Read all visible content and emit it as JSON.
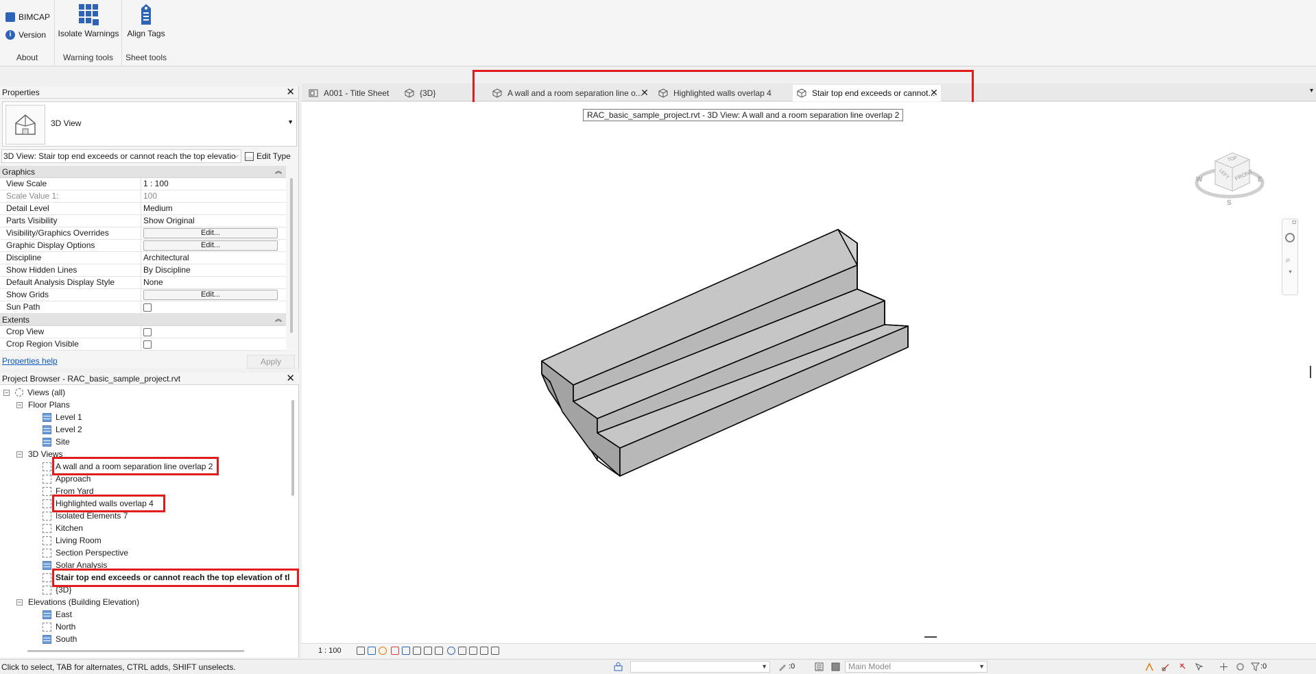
{
  "ribbon": {
    "about": {
      "label": "About",
      "bimcap": "BIMCAP",
      "version": "Version"
    },
    "warning_tools": {
      "label": "Warning tools",
      "isolate": "Isolate Warnings"
    },
    "sheet_tools": {
      "label": "Sheet tools",
      "align": "Align Tags"
    }
  },
  "tabs": [
    {
      "label": "A001 - Title Sheet",
      "icon": "sheet-icon"
    },
    {
      "label": "{3D}",
      "icon": "3d-view-icon"
    },
    {
      "label": "A wall and a room separation line o...",
      "icon": "3d-view-icon",
      "close": "✕"
    },
    {
      "label": "Highlighted walls overlap 4",
      "icon": "3d-view-icon"
    },
    {
      "label": "Stair top end exceeds or cannot...",
      "icon": "3d-view-icon",
      "close": "✕",
      "active": true
    }
  ],
  "tooltip": "RAC_basic_sample_project.rvt - 3D View: A wall and a room separation line overlap 2",
  "properties": {
    "title": "Properties",
    "type_name": "3D View",
    "instance": "3D View: Stair top end exceeds or cannot reach the top elevatio",
    "edit_type": "Edit Type",
    "sections": {
      "graphics": "Graphics",
      "extents": "Extents"
    },
    "rows": [
      {
        "name": "View Scale",
        "value": "1 : 100"
      },
      {
        "name": "Scale Value    1:",
        "value": "100"
      },
      {
        "name": "Detail Level",
        "value": "Medium"
      },
      {
        "name": "Parts Visibility",
        "value": "Show Original"
      },
      {
        "name": "Visibility/Graphics Overrides",
        "value": "Edit..."
      },
      {
        "name": "Graphic Display Options",
        "value": "Edit..."
      },
      {
        "name": "Discipline",
        "value": "Architectural"
      },
      {
        "name": "Show Hidden Lines",
        "value": "By Discipline"
      },
      {
        "name": "Default Analysis Display Style",
        "value": "None"
      },
      {
        "name": "Show Grids",
        "value": "Edit..."
      },
      {
        "name": "Sun Path",
        "value": ""
      },
      {
        "name": "Crop View",
        "value": ""
      },
      {
        "name": "Crop Region Visible",
        "value": ""
      }
    ],
    "help": "Properties help",
    "apply": "Apply"
  },
  "browser": {
    "title": "Project Browser - RAC_basic_sample_project.rvt",
    "views_all": "Views (all)",
    "floor_plans": "Floor Plans",
    "plans": [
      "Level 1",
      "Level 2",
      "Site"
    ],
    "views_3d": "3D Views",
    "views3d": [
      "A wall and a room separation line overlap 2",
      "Approach",
      "From Yard",
      "Highlighted walls overlap 4",
      "Isolated Elements 7",
      "Kitchen",
      "Living Room",
      "Section Perspective",
      "Solar Analysis",
      "Stair top end exceeds or cannot reach the top elevation of tl",
      "{3D}"
    ],
    "elevations": "Elevations (Building Elevation)",
    "elev_items": [
      "East",
      "North",
      "South"
    ]
  },
  "viewcube": {
    "top": "TOP",
    "left": "LEFT",
    "front": "FRONT",
    "w": "W",
    "e": "E",
    "s": "S"
  },
  "view_bar": {
    "scale": "1 : 100"
  },
  "status": {
    "text": "Click to select, TAB for alternates, CTRL adds, SHIFT unselects.",
    "zero1": ":0",
    "model": "Main Model",
    "zero2": ":0"
  },
  "colors": {
    "highlight": "#e01c1c",
    "link": "#0b57c2",
    "accent": "#2f63b6"
  }
}
